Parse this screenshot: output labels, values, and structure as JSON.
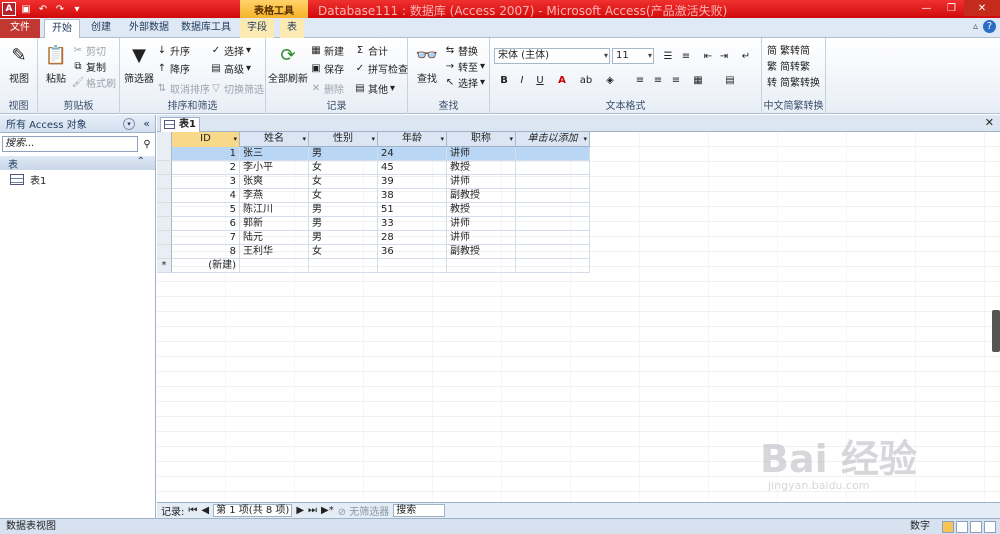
{
  "window": {
    "title": "Database111 : 数据库 (Access 2007) - Microsoft Access(产品激活失败)",
    "context_tools": "表格工具"
  },
  "ribbon_tabs": [
    "文件",
    "开始",
    "创建",
    "外部数据",
    "数据库工具",
    "字段",
    "表"
  ],
  "ribbon": {
    "view": {
      "label": "视图",
      "group": "视图"
    },
    "clipboard": {
      "paste": "粘贴",
      "cut": "剪切",
      "copy": "复制",
      "format_painter": "格式刷",
      "group": "剪贴板"
    },
    "sort_filter": {
      "filter": "筛选器",
      "asc": "升序",
      "desc": "降序",
      "remove_sort": "取消排序",
      "selection": "选择",
      "advanced": "高级",
      "toggle_filter": "切换筛选",
      "group": "排序和筛选"
    },
    "records": {
      "refresh": "全部刷新",
      "new": "新建",
      "save": "保存",
      "delete": "删除",
      "totals": "合计",
      "spelling": "拼写检查",
      "more": "其他",
      "group": "记录"
    },
    "find": {
      "find": "查找",
      "replace": "替换",
      "goto": "转至",
      "select": "选择",
      "group": "查找"
    },
    "text_format": {
      "font": "宋体 (主体)",
      "size": "11",
      "group": "文本格式"
    },
    "chinese_conv": {
      "t2s": "繁转简",
      "s2t": "简转繁",
      "conv": "简繁转换",
      "group": "中文简繁转换"
    }
  },
  "nav_pane": {
    "title": "所有 Access 对象",
    "search_placeholder": "搜索...",
    "category": "表",
    "items": [
      "表1"
    ]
  },
  "doc_tab": "表1",
  "table": {
    "columns": [
      "ID",
      "姓名",
      "性别",
      "年龄",
      "职称",
      "单击以添加"
    ],
    "rows": [
      [
        "1",
        "张三",
        "男",
        "24",
        "讲师"
      ],
      [
        "2",
        "李小平",
        "女",
        "45",
        "教授"
      ],
      [
        "3",
        "张爽",
        "女",
        "39",
        "讲师"
      ],
      [
        "4",
        "李燕",
        "女",
        "38",
        "副教授"
      ],
      [
        "5",
        "陈江川",
        "男",
        "51",
        "教授"
      ],
      [
        "6",
        "郭新",
        "男",
        "33",
        "讲师"
      ],
      [
        "7",
        "陆元",
        "男",
        "28",
        "讲师"
      ],
      [
        "8",
        "王利华",
        "女",
        "36",
        "副教授"
      ]
    ],
    "new_row": "(新建)",
    "new_marker": "*"
  },
  "record_bar": {
    "label": "记录:",
    "position": "第 1 项(共 8 项)",
    "no_filter": "无筛选器",
    "search": "搜索"
  },
  "status": {
    "left": "数据表视图",
    "right": "数字"
  },
  "watermark": {
    "main": "Bai 经验",
    "sub": "jingyan.baidu.com"
  }
}
